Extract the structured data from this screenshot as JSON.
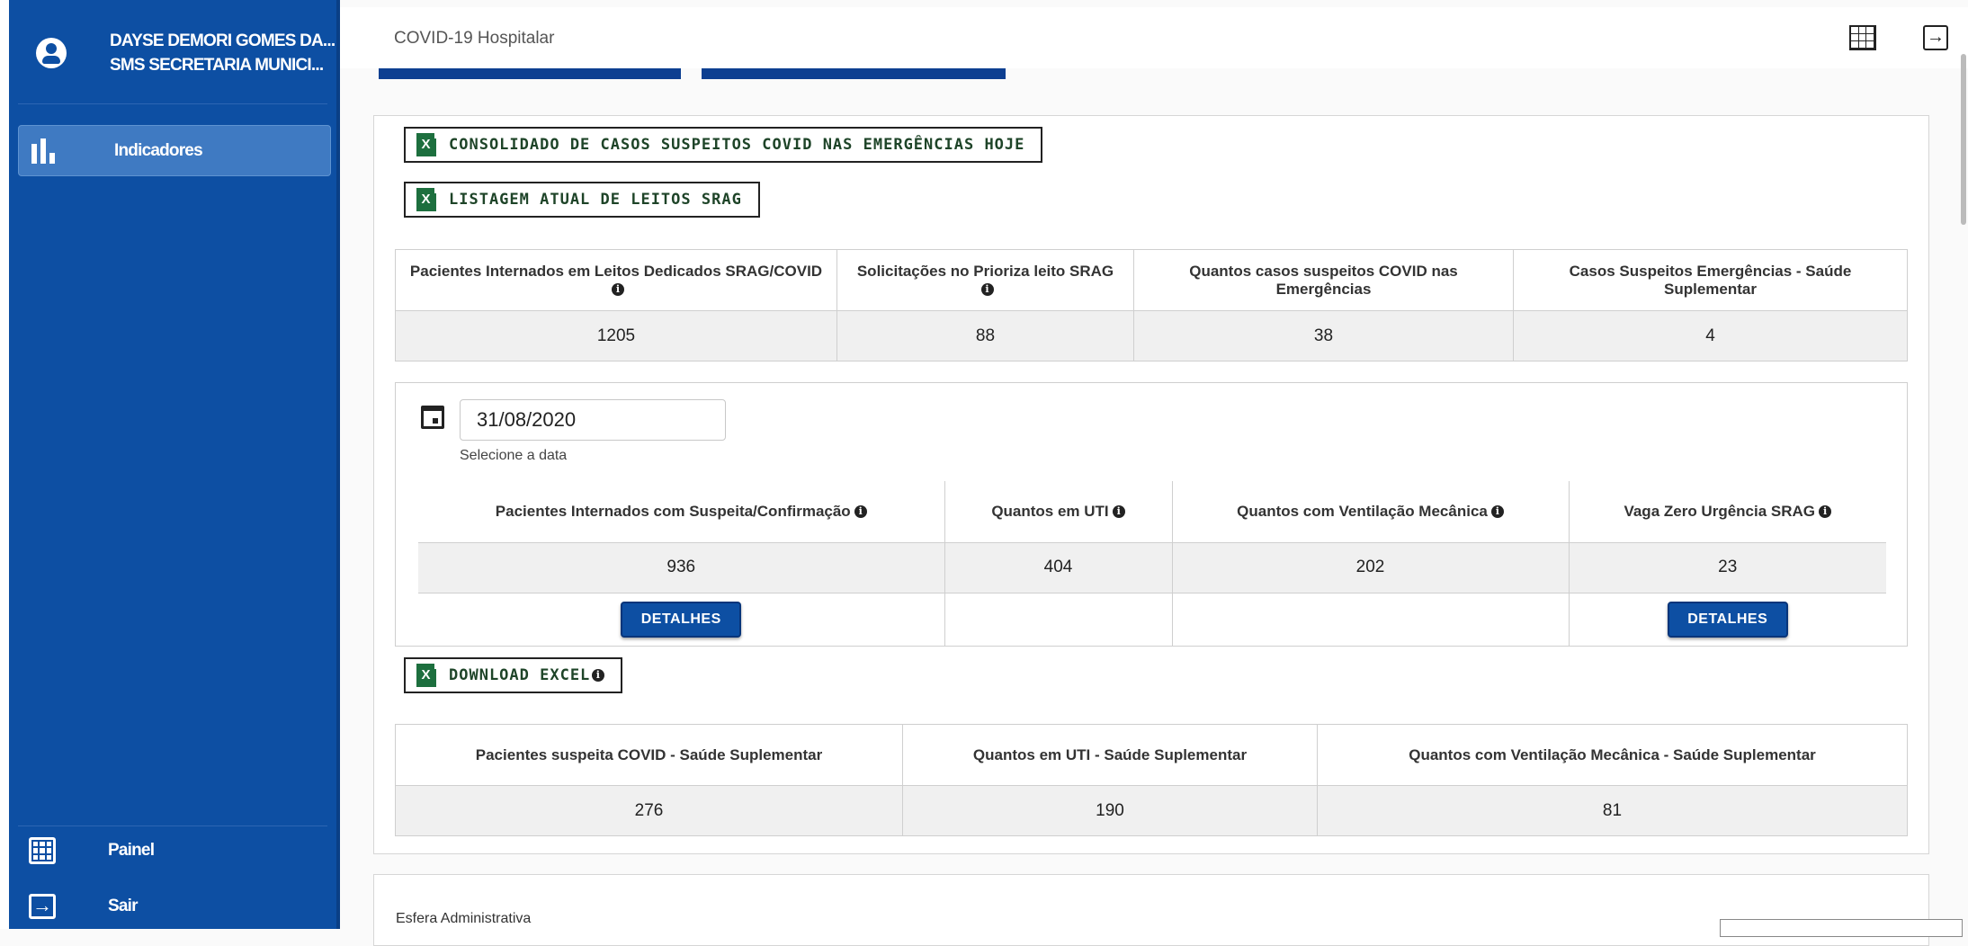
{
  "user": {
    "name": "DAYSE DEMORI GOMES DA...",
    "org": "SMS SECRETARIA MUNICI..."
  },
  "sidebar": {
    "items": [
      {
        "label": "Indicadores",
        "icon": "bar-chart-icon"
      },
      {
        "label": "Painel",
        "icon": "grid-icon"
      },
      {
        "label": "Sair",
        "icon": "exit-icon"
      }
    ]
  },
  "header": {
    "title": "COVID-19 Hospitalar"
  },
  "buttons": {
    "consolidado": "CONSOLIDADO DE CASOS SUSPEITOS COVID NAS EMERGÊNCIAS HOJE",
    "listagem": "LISTAGEM ATUAL DE LEITOS SRAG",
    "download": "DOWNLOAD EXCEL",
    "detalhes": "DETALHES"
  },
  "summary": {
    "headers": [
      "Pacientes Internados em Leitos Dedicados SRAG/COVID",
      "Solicitações no Prioriza leito SRAG",
      "Quantos casos suspeitos COVID nas Emergências",
      "Casos Suspeitos Emergências - Saúde Suplementar"
    ],
    "values": [
      "1205",
      "88",
      "38",
      "4"
    ]
  },
  "date_filter": {
    "value": "31/08/2020",
    "hint": "Selecione a data"
  },
  "daily": {
    "headers": [
      "Pacientes Internados com Suspeita/Confirmação",
      "Quantos em UTI",
      "Quantos com Ventilação Mecânica",
      "Vaga Zero Urgência SRAG"
    ],
    "values": [
      "936",
      "404",
      "202",
      "23"
    ]
  },
  "supplementary": {
    "headers": [
      "Pacientes suspeita COVID - Saúde Suplementar",
      "Quantos em UTI - Saúde Suplementar",
      "Quantos com Ventilação Mecânica - Saúde Suplementar"
    ],
    "values": [
      "276",
      "190",
      "81"
    ]
  },
  "bottom_panel": {
    "label": "Esfera Administrativa"
  },
  "colors": {
    "sidebar": "#0d4fa3",
    "sidebar_active": "#3f7ac2",
    "button": "#0d4fa3",
    "excel_green": "#1d6f3e"
  }
}
